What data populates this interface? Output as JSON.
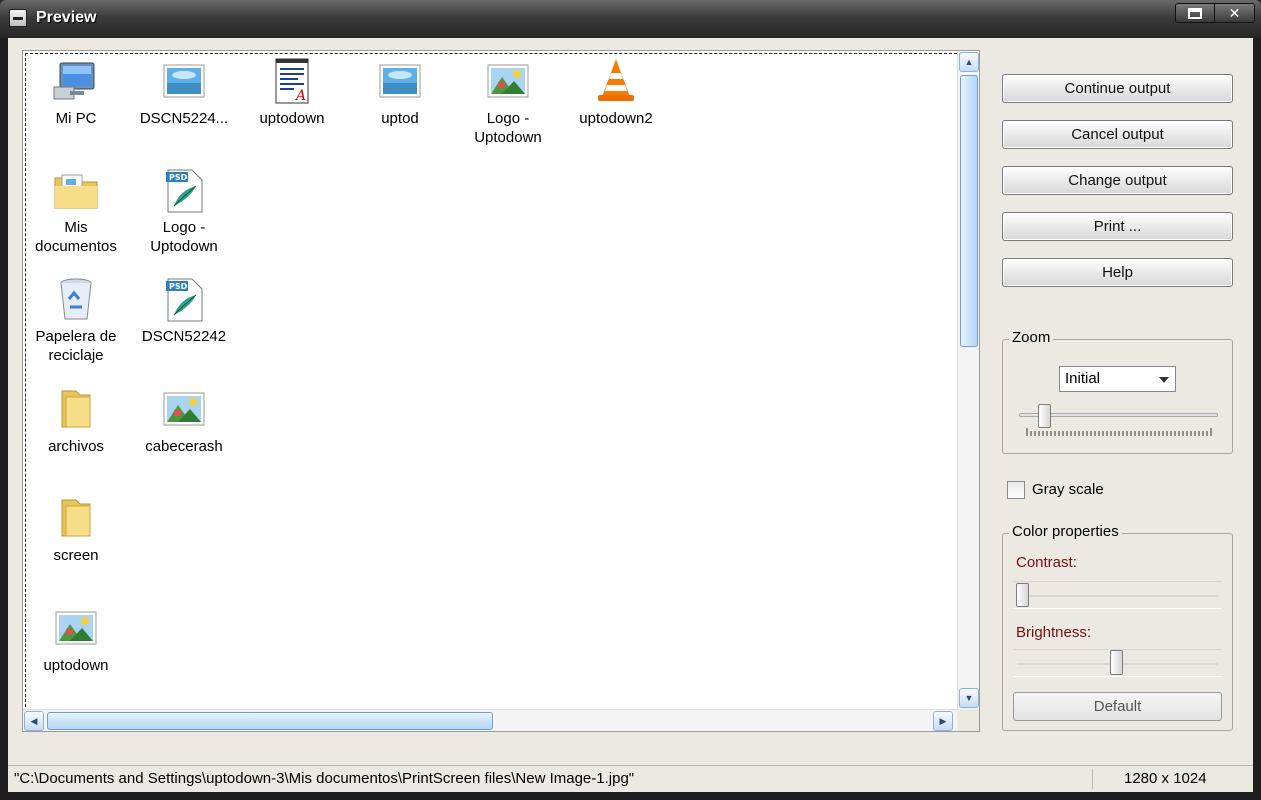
{
  "window": {
    "title": "Preview"
  },
  "desktop_icons": [
    {
      "label": "Mi PC",
      "icon": "computer-icon"
    },
    {
      "label": "DSCN5224...",
      "icon": "image-file-icon"
    },
    {
      "label": "uptodown",
      "icon": "text-document-icon"
    },
    {
      "label": "uptod",
      "icon": "image-file-icon"
    },
    {
      "label": "Logo -\nUptodown",
      "icon": "picture-icon"
    },
    {
      "label": "uptodown2",
      "icon": "vlc-cone-icon"
    },
    {
      "label": "Mis\ndocumentos",
      "icon": "documents-folder-icon"
    },
    {
      "label": "Logo -\nUptodown",
      "icon": "psd-file-icon"
    },
    {
      "label": "Papelera de\nreciclaje",
      "icon": "recycle-bin-icon"
    },
    {
      "label": "DSCN52242",
      "icon": "psd-file-icon"
    },
    {
      "label": "archivos",
      "icon": "folder-icon"
    },
    {
      "label": "cabecerash",
      "icon": "picture-icon"
    },
    {
      "label": "screen",
      "icon": "folder-icon"
    },
    {
      "label": "uptodown",
      "icon": "picture-icon"
    }
  ],
  "buttons": {
    "continue": "Continue output",
    "cancel": "Cancel output",
    "change": "Change output",
    "print": "Print ...",
    "help": "Help"
  },
  "zoom": {
    "label": "Zoom",
    "selected": "Initial"
  },
  "gray_scale": {
    "label": "Gray scale",
    "checked": false
  },
  "color_properties": {
    "label": "Color properties",
    "contrast_label": "Contrast:",
    "brightness_label": "Brightness:",
    "default_label": "Default"
  },
  "status": {
    "path": "\"C:\\Documents and Settings\\uptodown-3\\Mis documentos\\PrintScreen files\\New Image-1.jpg\"",
    "size": "1280 x 1024"
  }
}
